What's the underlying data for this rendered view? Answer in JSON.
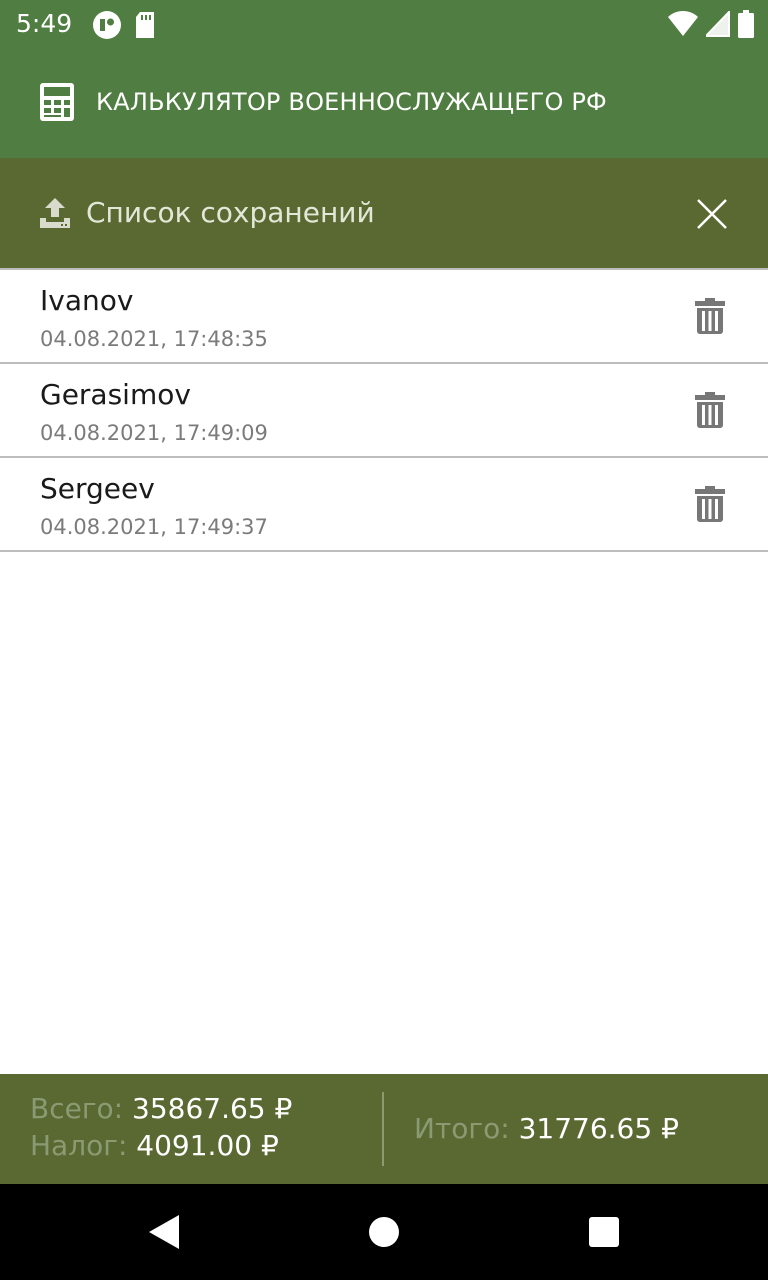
{
  "status_bar": {
    "time": "5:49",
    "icons_left": [
      "app-notification-icon",
      "sd-card-icon"
    ],
    "icons_right": [
      "wifi-icon",
      "signal-icon",
      "battery-icon"
    ]
  },
  "app_bar": {
    "title": "КАЛЬКУЛЯТОР ВОЕННОСЛУЖАЩЕГО РФ",
    "icon": "calculator-icon"
  },
  "saves_panel": {
    "title": "Список сохранений",
    "icon": "upload-icon",
    "close_icon": "close-icon"
  },
  "saves": [
    {
      "name": "Ivanov",
      "date": "04.08.2021, 17:48:35"
    },
    {
      "name": "Gerasimov",
      "date": "04.08.2021, 17:49:09"
    },
    {
      "name": "Sergeev",
      "date": "04.08.2021, 17:49:37"
    }
  ],
  "footer": {
    "total_label": "Всего:",
    "total_value": "35867.65 ₽",
    "tax_label": "Налог:",
    "tax_value": "4091.00 ₽",
    "net_label": "Итого:",
    "net_value": "31776.65 ₽"
  },
  "nav_bar": {
    "icons": [
      "back-icon",
      "home-icon",
      "recents-icon"
    ]
  },
  "colors": {
    "app_bar": "#507d41",
    "panel": "#5a6932",
    "nav_bar": "#000000",
    "delete_icon": "#777777"
  }
}
